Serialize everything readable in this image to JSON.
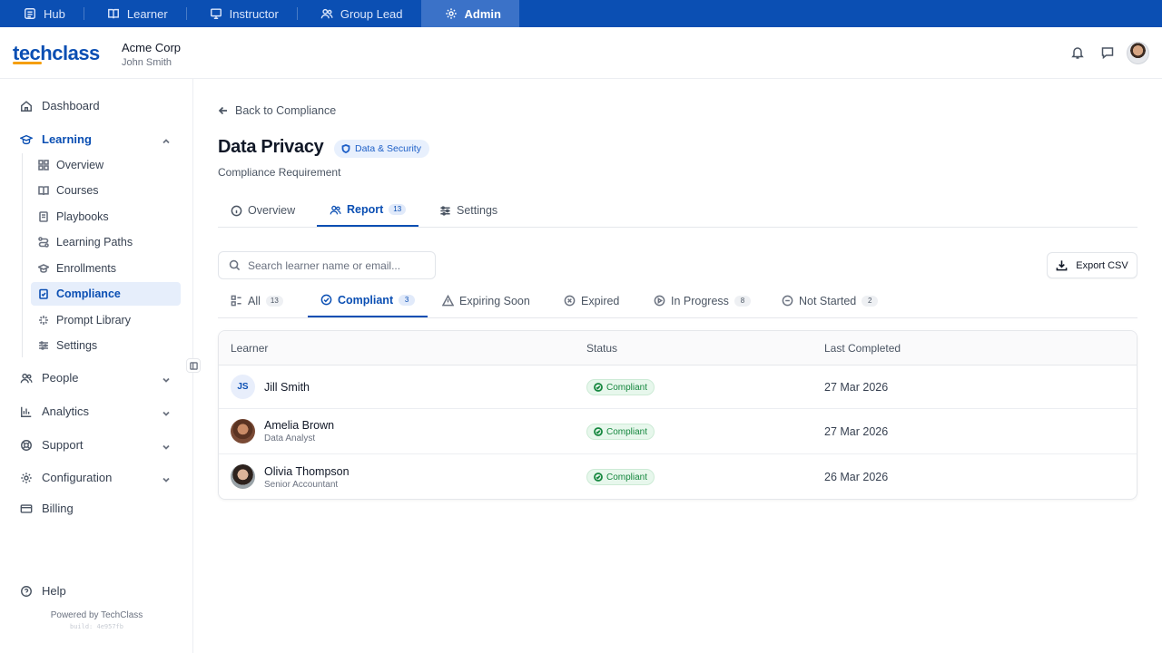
{
  "topnav": {
    "tabs": [
      {
        "label": "Hub",
        "icon": "hub-icon"
      },
      {
        "label": "Learner",
        "icon": "book-icon"
      },
      {
        "label": "Instructor",
        "icon": "monitor-icon"
      },
      {
        "label": "Group Lead",
        "icon": "users-icon"
      },
      {
        "label": "Admin",
        "icon": "gear-icon",
        "active": true
      }
    ]
  },
  "header": {
    "logo": "techclass",
    "org_name": "Acme Corp",
    "user_name": "John Smith"
  },
  "sidebar": {
    "dashboard": "Dashboard",
    "learning": "Learning",
    "learning_items": [
      "Overview",
      "Courses",
      "Playbooks",
      "Learning Paths",
      "Enrollments",
      "Compliance",
      "Prompt Library",
      "Settings"
    ],
    "active_item": "Compliance",
    "people": "People",
    "analytics": "Analytics",
    "support": "Support",
    "configuration": "Configuration",
    "billing": "Billing",
    "help": "Help",
    "powered_by": "Powered by TechClass",
    "build": "build: 4e957fb"
  },
  "page": {
    "back_label": "Back to Compliance",
    "title": "Data Privacy",
    "category": "Data & Security",
    "subtitle": "Compliance Requirement",
    "tabs": [
      {
        "label": "Overview",
        "icon": "info-icon"
      },
      {
        "label": "Report",
        "icon": "users-icon",
        "count": "13",
        "active": true
      },
      {
        "label": "Settings",
        "icon": "sliders-icon"
      }
    ],
    "search_placeholder": "Search learner name or email...",
    "export_label": "Export CSV",
    "filters": [
      {
        "label": "All",
        "count": "13",
        "icon": "list-icon"
      },
      {
        "label": "Compliant",
        "count": "3",
        "icon": "check-circle-icon",
        "active": true
      },
      {
        "label": "Expiring Soon",
        "icon": "warning-icon"
      },
      {
        "label": "Expired",
        "icon": "x-circle-icon"
      },
      {
        "label": "In Progress",
        "count": "8",
        "icon": "play-circle-icon"
      },
      {
        "label": "Not Started",
        "count": "2",
        "icon": "minus-circle-icon"
      }
    ]
  },
  "table": {
    "columns": [
      "Learner",
      "Status",
      "Last Completed"
    ],
    "rows": [
      {
        "initials": "JS",
        "name": "Jill Smith",
        "role": "",
        "status": "Compliant",
        "date": "27 Mar 2026"
      },
      {
        "name": "Amelia Brown",
        "role": "Data Analyst",
        "status": "Compliant",
        "date": "27 Mar 2026"
      },
      {
        "name": "Olivia Thompson",
        "role": "Senior Accountant",
        "status": "Compliant",
        "date": "26 Mar 2026"
      }
    ]
  },
  "colors": {
    "brand": "#0b4fb3",
    "accent": "#f59e0b",
    "compliant": "#16873f"
  }
}
